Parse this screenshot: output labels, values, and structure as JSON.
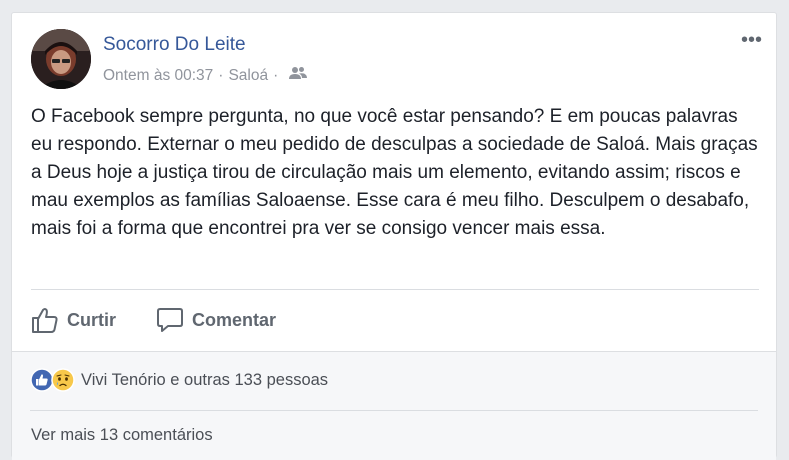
{
  "post": {
    "author": "Socorro Do Leite",
    "timestamp": "Ontem às 00:37",
    "separator": "·",
    "location": "Saloá",
    "privacy_icon": "friends-icon",
    "more_label": "•••",
    "text": "O Facebook sempre pergunta, no que você estar pensando? E em poucas palavras eu respondo. Externar o meu pedido de desculpas a sociedade de Saloá. Mais graças a Deus hoje a justiça tirou de circulação mais um elemento, evitando assim; riscos e mau exemplos as famílias Saloaense. Esse cara é meu filho. Desculpem o desabafo, mais foi a forma que encontrei pra ver se consigo vencer mais essa."
  },
  "actions": {
    "like_label": "Curtir",
    "like_icon": "thumbs-up-icon",
    "comment_label": "Comentar",
    "comment_icon": "speech-bubble-icon"
  },
  "reactions": {
    "icons": [
      "like-reaction-icon",
      "sad-reaction-icon"
    ],
    "summary": "Vivi Tenório e outras 133 pessoas"
  },
  "comments": {
    "more_label": "Ver mais 13 comentários"
  },
  "colors": {
    "link_blue": "#365899",
    "like_blue": "#4267b2",
    "sad_yellow": "#f7c84a",
    "muted": "#90949c",
    "text": "#1d2129"
  }
}
